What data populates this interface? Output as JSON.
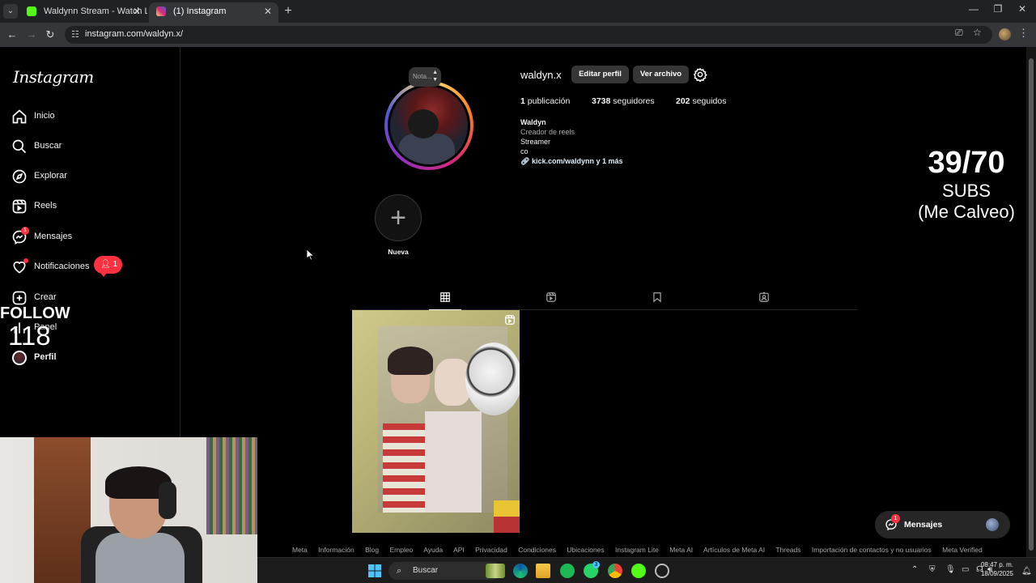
{
  "browser": {
    "tabs": [
      {
        "title": "Waldynn Stream - Watch Live o",
        "favicon_color": "#53fc18",
        "active": false
      },
      {
        "title": "(1) Instagram",
        "favicon_color": "#d62976",
        "active": true
      }
    ],
    "url": "instagram.com/waldyn.x/"
  },
  "sidebar": {
    "logo": "Instagram",
    "items": [
      {
        "label": "Inicio",
        "icon": "home-icon"
      },
      {
        "label": "Buscar",
        "icon": "search-icon"
      },
      {
        "label": "Explorar",
        "icon": "compass-icon"
      },
      {
        "label": "Reels",
        "icon": "reels-icon"
      },
      {
        "label": "Mensajes",
        "icon": "messenger-icon",
        "badge": "1"
      },
      {
        "label": "Notificaciones",
        "icon": "heart-icon"
      },
      {
        "label": "Crear",
        "icon": "plus-square-icon"
      },
      {
        "label": "Panel",
        "icon": "dashboard-icon"
      },
      {
        "label": "Perfil",
        "icon": "avatar-icon"
      }
    ],
    "notif_popup_count": "1"
  },
  "overlay": {
    "follow_label": "FOLLOW",
    "follow_count": "118",
    "subs_count": "39/70",
    "subs_label": "SUBS",
    "subs_note": "(Me Calveo)"
  },
  "profile": {
    "note_placeholder": "Nota...",
    "username": "waldyn.x",
    "edit_button": "Editar perfil",
    "archive_button": "Ver archivo",
    "stats": {
      "posts_count": "1",
      "posts_label": "publicación",
      "followers_count": "3738",
      "followers_label": "seguidores",
      "following_count": "202",
      "following_label": "seguidos"
    },
    "bio": {
      "name": "Waldyn",
      "category": "Creador de reels",
      "line1": "Streamer",
      "line2": "co",
      "link": "kick.com/waldynn y 1 más"
    },
    "highlight_new_label": "Nueva"
  },
  "footer": {
    "links": [
      "Meta",
      "Información",
      "Blog",
      "Empleo",
      "Ayuda",
      "API",
      "Privacidad",
      "Condiciones",
      "Ubicaciones",
      "Instagram Lite",
      "Meta AI",
      "Artículos de Meta AI",
      "Threads",
      "Importación de contactos y no usuarios",
      "Meta Verified"
    ]
  },
  "messages_pill": {
    "label": "Mensajes",
    "badge": "1"
  },
  "taskbar": {
    "search_placeholder": "Buscar",
    "whatsapp_badge": "3",
    "time": "08:47 p. m.",
    "date": "18/09/2025"
  },
  "colors": {
    "badge_red": "#ff3040",
    "kick_green": "#53fc18"
  }
}
